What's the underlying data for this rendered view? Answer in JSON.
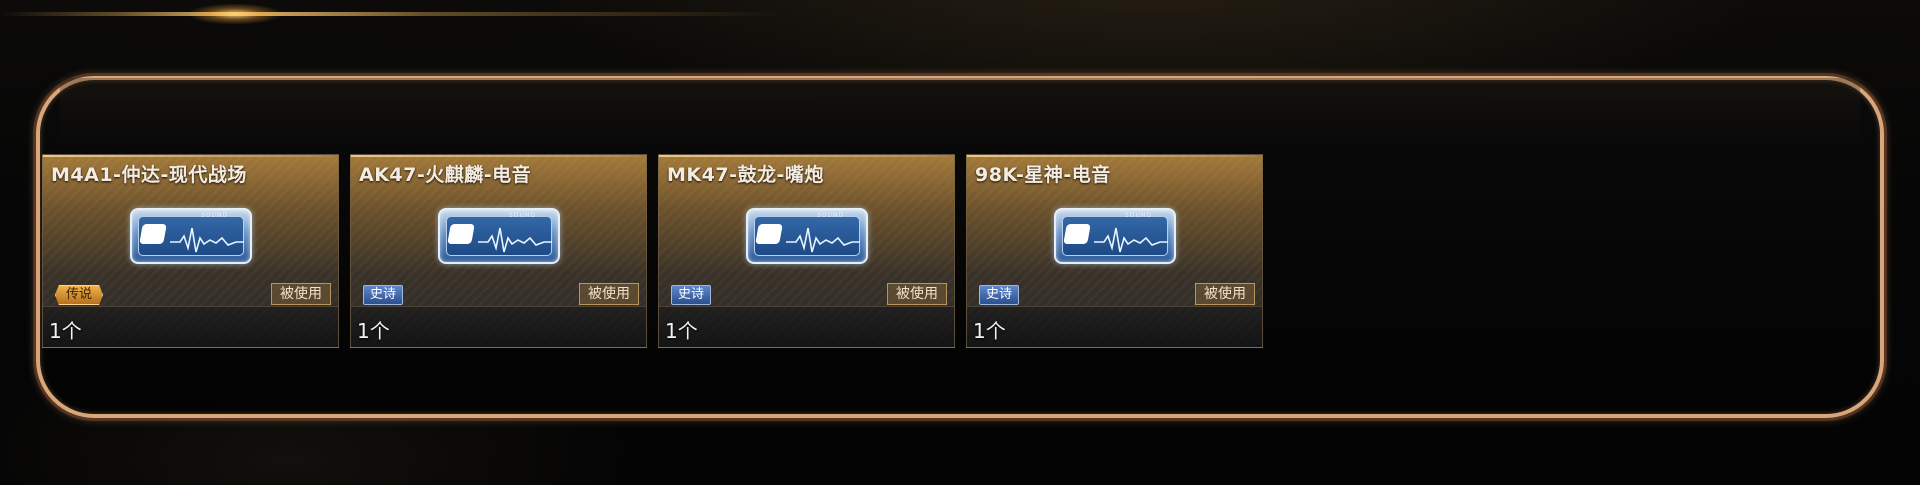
{
  "colors": {
    "frame_border": "#d9a67a",
    "card_top": "#a47a3a",
    "rarity_epic": "#2b4f8f",
    "rarity_legendary": "#f0b24a"
  },
  "cards": [
    {
      "name": "M4A1-仲达-现代战场",
      "icon": "sound-card-icon",
      "rarity": "传说",
      "rarity_color": "gold",
      "status": "被使用",
      "count": "1个"
    },
    {
      "name": "AK47-火麒麟-电音",
      "icon": "sound-card-icon",
      "rarity": "史诗",
      "rarity_color": "blue",
      "status": "被使用",
      "count": "1个"
    },
    {
      "name": "MK47-鼓龙-嘴炮",
      "icon": "sound-card-icon",
      "rarity": "史诗",
      "rarity_color": "blue",
      "status": "被使用",
      "count": "1个"
    },
    {
      "name": "98K-星神-电音",
      "icon": "sound-card-icon",
      "rarity": "史诗",
      "rarity_color": "blue",
      "status": "被使用",
      "count": "1个"
    }
  ]
}
